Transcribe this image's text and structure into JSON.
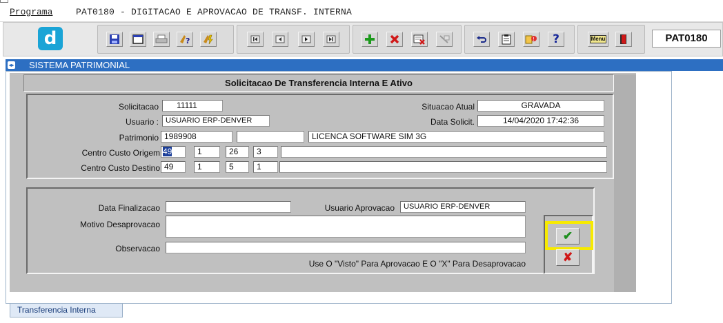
{
  "menubar": {
    "menu_label": "Programa",
    "title": "PAT0180 - DIGITACAO E APROVACAO DE TRANSF. INTERNA"
  },
  "toolbar": {
    "logo_letter": "d",
    "program_code": "PAT0180",
    "icons": [
      "save-icon",
      "window-icon",
      "print-icon",
      "help-query-icon",
      "execute-query-icon",
      "first-record-icon",
      "previous-record-icon",
      "next-record-icon",
      "last-record-icon",
      "insert-record-icon",
      "delete-record-icon",
      "clear-record-icon",
      "duplicate-record-icon",
      "undo-icon",
      "clipboard-icon",
      "list-values-icon",
      "help-icon",
      "menu-icon",
      "exit-icon"
    ],
    "menu_icon_text": "Menu",
    "help_icon_text": "?"
  },
  "system": {
    "title": "SISTEMA PATRIMONIAL"
  },
  "form": {
    "title": "Solicitacao De Transferencia Interna E Ativo",
    "solicitacao_label": "Solicitacao",
    "solicitacao_value": "11111",
    "situacao_label": "Situacao Atual",
    "situacao_value": "GRAVADA",
    "usuario_label": "Usuario :",
    "usuario_value": "USUARIO ERP-DENVER",
    "data_solicit_label": "Data Solicit.",
    "data_solicit_value": "14/04/2020 17:42:36",
    "patrimonio_label": "Patrimonio",
    "patrimonio_value": "1989908",
    "patrimonio_extra": "",
    "patrimonio_desc": "LICENCA SOFTWARE SIM 3G",
    "origem_label": "Centro Custo Origem",
    "origem_values": [
      "49",
      "1",
      "26",
      "3",
      ""
    ],
    "destino_label": "Centro Custo Destino",
    "destino_values": [
      "49",
      "1",
      "5",
      "1",
      ""
    ]
  },
  "approval": {
    "data_final_label": "Data Finalizacao",
    "data_final_value": "",
    "usuario_aprov_label": "Usuario Aprovacao",
    "usuario_aprov_value": "USUARIO ERP-DENVER",
    "motivo_label": "Motivo Desaprovacao",
    "motivo_value": "",
    "observacao_label": "Observacao",
    "observacao_value": "",
    "hint": "Use O \"Visto\" Para Aprovacao E O \"X\" Para Desaprovacao",
    "approve_glyph": "✔",
    "reject_glyph": "✘"
  },
  "tabs": {
    "active": "Transferencia Interna"
  },
  "colors": {
    "system_bar": "#2d6fc2",
    "highlight": "#f7ea00",
    "logo": "#1aa4d6"
  }
}
